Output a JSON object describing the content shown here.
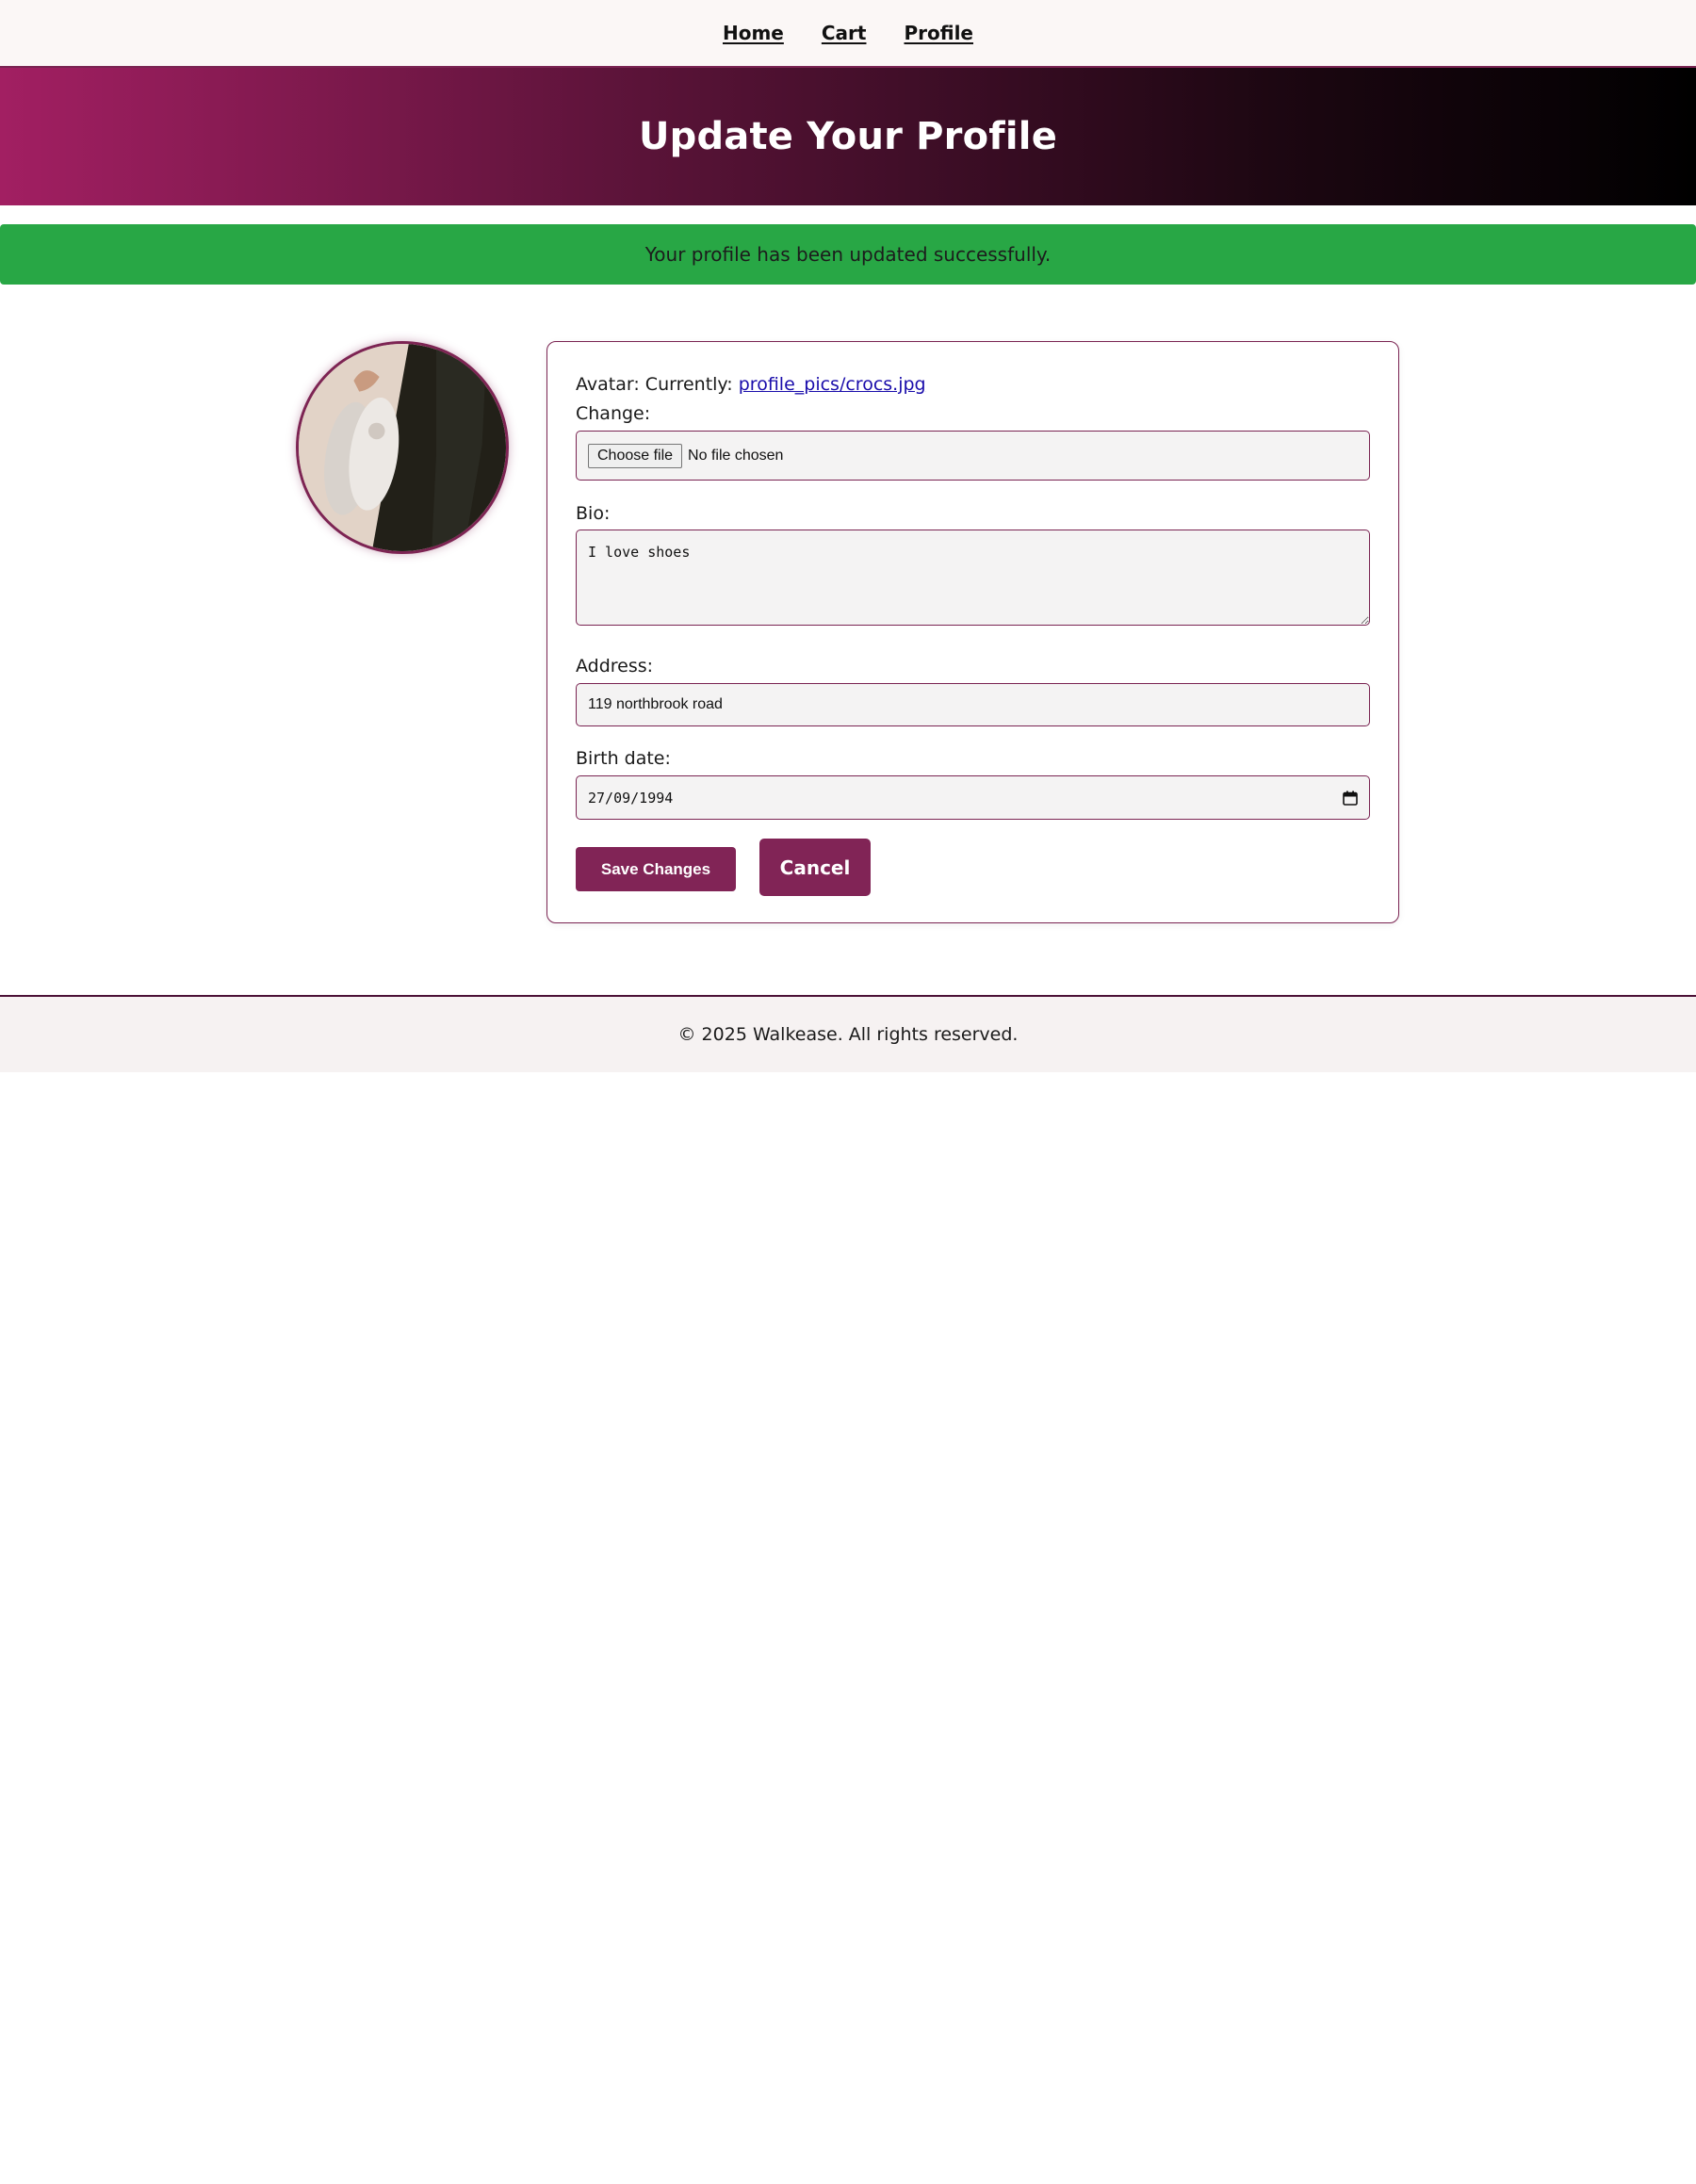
{
  "nav": {
    "items": [
      {
        "label": "Home"
      },
      {
        "label": "Cart"
      },
      {
        "label": "Profile"
      }
    ]
  },
  "header": {
    "title": "Update Your Profile"
  },
  "alert": {
    "message": "Your profile has been updated successfully."
  },
  "form": {
    "avatar": {
      "label": "Avatar:",
      "current_prefix": "Currently:",
      "current_file": "profile_pics/crocs.jpg",
      "change_label": "Change:",
      "choose_button": "Choose file",
      "file_status": "No file chosen"
    },
    "bio": {
      "label": "Bio:",
      "value": "I love shoes"
    },
    "address": {
      "label": "Address:",
      "value": "119 northbrook road"
    },
    "birth_date": {
      "label": "Birth date:",
      "value": "27/09/1994"
    },
    "save_label": "Save Changes",
    "cancel_label": "Cancel"
  },
  "footer": {
    "text": "© 2025 Walkease. All rights reserved."
  },
  "colors": {
    "accent": "#812456",
    "success": "#28a745",
    "link": "#1a0dab"
  },
  "icons": {
    "calendar": "calendar-icon"
  }
}
